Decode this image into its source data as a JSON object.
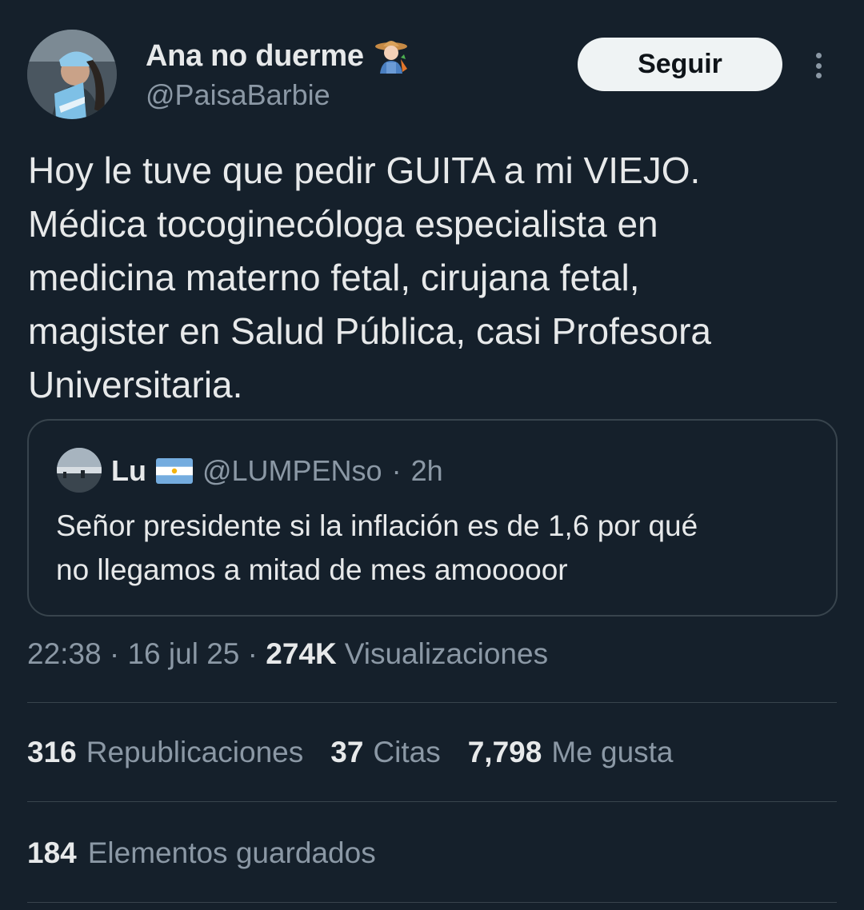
{
  "author": {
    "display_name": "Ana no duerme",
    "name_emoji": "farmer-emoji",
    "handle": "@PaisaBarbie",
    "avatar": "profile-photo"
  },
  "actions": {
    "follow_label": "Seguir",
    "more_icon": "more-vertical-icon"
  },
  "tweet": {
    "text": "Hoy le tuve que pedir GUITA a mi VIEJO.\nMédica tocoginecóloga especialista en\nmedicina materno fetal, cirujana fetal,\nmagister en Salud Pública, casi Profesora\nUniversitaria."
  },
  "quote": {
    "name": "Lu",
    "flag": "argentina-flag",
    "handle": "@LUMPENso",
    "separator": "·",
    "time": "2h",
    "text": "Señor presidente si la inflación es de 1,6 por qué\nno llegamos a mitad de mes amooooor"
  },
  "meta": {
    "time": "22:38",
    "sep1": " · ",
    "date": "16 jul 25",
    "sep2": " · ",
    "views_count": "274K",
    "views_label": "Visualizaciones"
  },
  "stats": {
    "reposts_count": "316",
    "reposts_label": "Republicaciones",
    "quotes_count": "37",
    "quotes_label": "Citas",
    "likes_count": "7,798",
    "likes_label": "Me gusta"
  },
  "bookmarks": {
    "count": "184",
    "label": "Elementos guardados"
  },
  "colors": {
    "background": "#15202b",
    "text_primary": "#e7e9ea",
    "text_secondary": "#8b98a5",
    "border": "#38444d",
    "button_bg": "#eff3f4"
  }
}
